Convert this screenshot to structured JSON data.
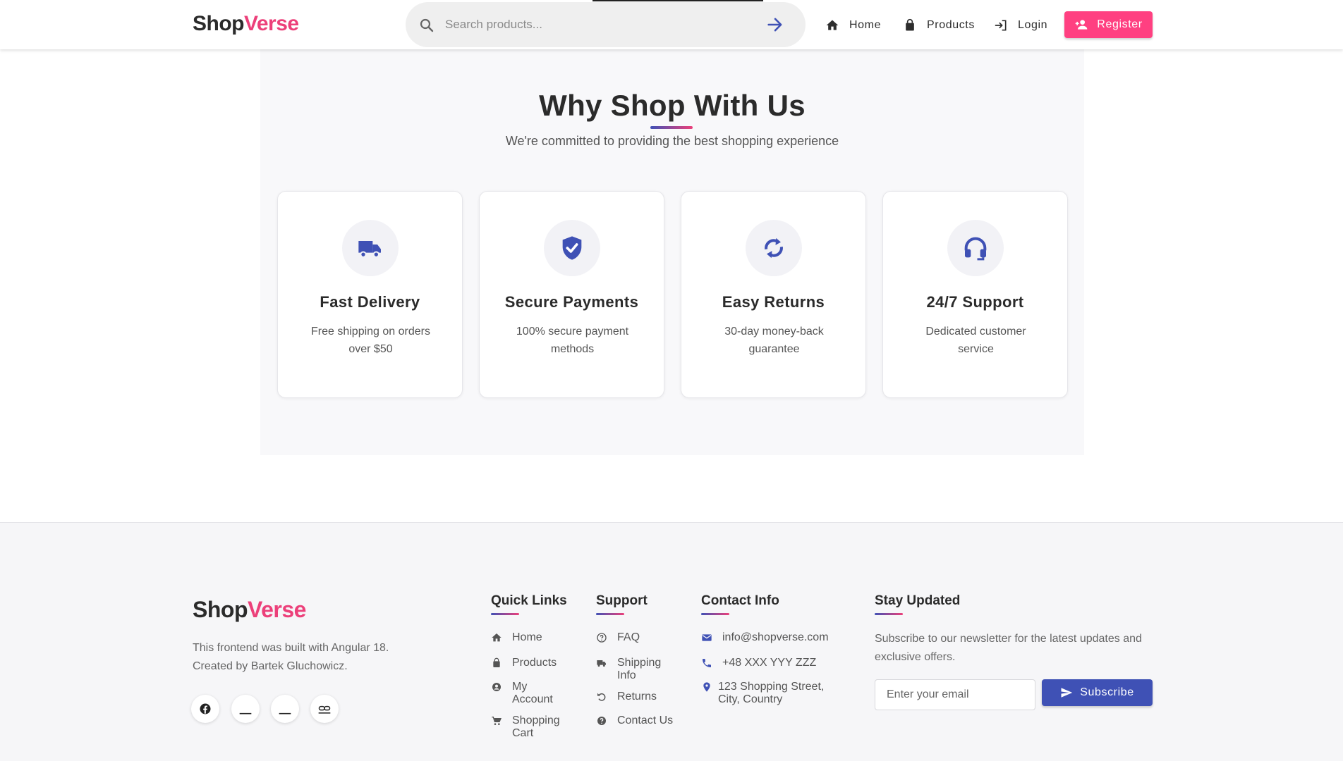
{
  "header": {
    "logo_part1": "Shop",
    "logo_part2": "Verse",
    "search_placeholder": "Search products...",
    "nav": [
      {
        "label": "Home",
        "icon": "home-icon"
      },
      {
        "label": "Products",
        "icon": "shopping-bag-icon"
      },
      {
        "label": "Login",
        "icon": "login-icon"
      }
    ],
    "register_label": "Register"
  },
  "features": {
    "title": "Why Shop With Us",
    "subtitle": "We're committed to providing the best shopping experience",
    "cards": [
      {
        "title": "Fast Delivery",
        "description": "Free shipping on orders over $50",
        "icon": "truck-icon"
      },
      {
        "title": "Secure Payments",
        "description": "100% secure payment methods",
        "icon": "shield-check-icon"
      },
      {
        "title": "Easy Returns",
        "description": "30-day money-back guarantee",
        "icon": "sync-icon"
      },
      {
        "title": "24/7 Support",
        "description": "Dedicated customer service",
        "icon": "headset-icon"
      }
    ]
  },
  "footer": {
    "logo_part1": "Shop",
    "logo_part2": "Verse",
    "description": "This frontend was built with Angular 18. Created by Bartek Gluchowicz.",
    "social_icons": [
      "facebook-icon",
      "social-icon",
      "social-icon",
      "link-icon"
    ],
    "quick_links": {
      "title": "Quick Links",
      "items": [
        {
          "label": "Home",
          "icon": "home-icon"
        },
        {
          "label": "Products",
          "icon": "shopping-bag-icon"
        },
        {
          "label": "My Account",
          "icon": "account-circle-icon"
        },
        {
          "label": "Shopping Cart",
          "icon": "cart-icon"
        }
      ]
    },
    "support": {
      "title": "Support",
      "items": [
        {
          "label": "FAQ",
          "icon": "help-outline-icon"
        },
        {
          "label": "Shipping Info",
          "icon": "truck-icon"
        },
        {
          "label": "Returns",
          "icon": "undo-icon"
        },
        {
          "label": "Contact Us",
          "icon": "help-icon"
        }
      ]
    },
    "contact": {
      "title": "Contact Info",
      "items": [
        {
          "label": "info@shopverse.com",
          "icon": "email-icon"
        },
        {
          "label": "+48 XXX YYY ZZZ",
          "icon": "phone-icon"
        },
        {
          "label": "123 Shopping Street, City, Country",
          "icon": "location-icon"
        }
      ]
    },
    "newsletter": {
      "title": "Stay Updated",
      "text": "Subscribe to our newsletter for the latest updates and exclusive offers.",
      "email_placeholder": "Enter your email",
      "subscribe_label": "Subscribe"
    }
  },
  "colors": {
    "primary": "#3f51b5",
    "accent": "#ff4081",
    "brand_pink": "#ec407a"
  }
}
